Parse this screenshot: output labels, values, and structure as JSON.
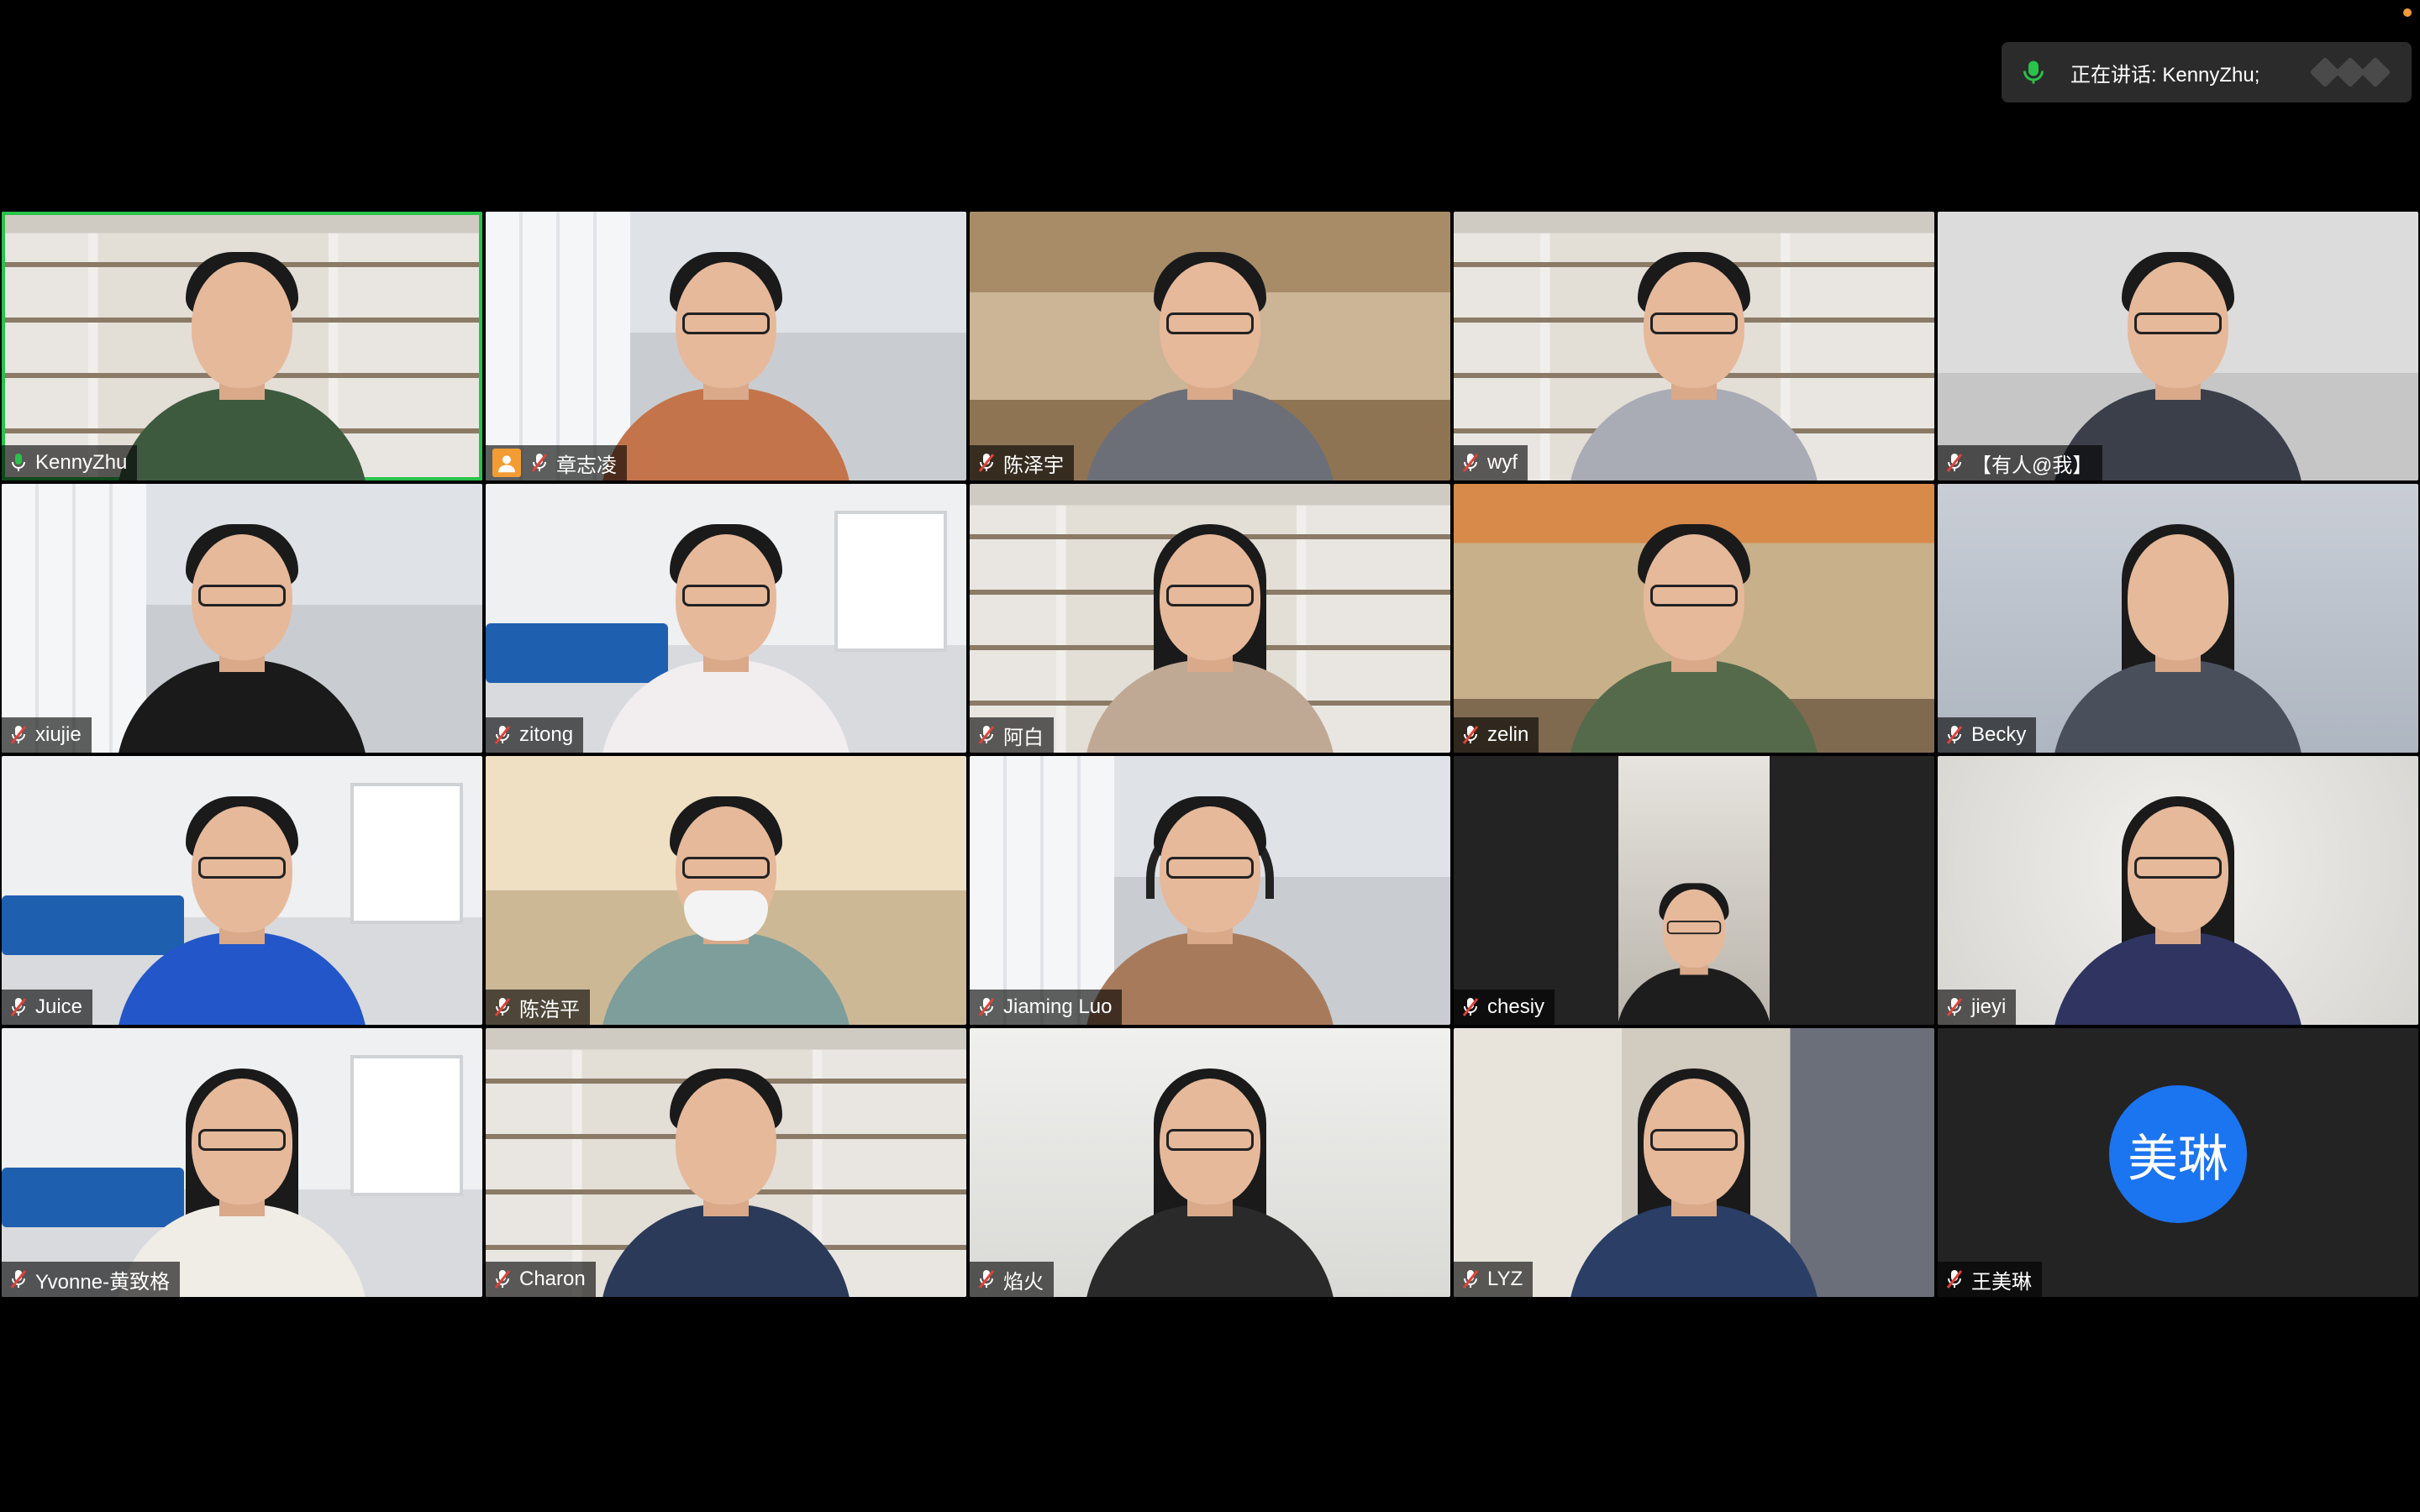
{
  "speaker": {
    "label": "正在讲话: KennyZhu;"
  },
  "participants": [
    {
      "name": "KennyZhu",
      "muted": false,
      "active": true,
      "bg": "bg-shelf"
    },
    {
      "name": "章志凌",
      "muted": true,
      "host_icon": true,
      "bg": "bg-office"
    },
    {
      "name": "陈泽宇",
      "muted": true,
      "bg": "bg-dorm"
    },
    {
      "name": "wyf",
      "muted": true,
      "bg": "bg-shelf"
    },
    {
      "name": "【有人@我】",
      "muted": true,
      "bg": "bg-room"
    },
    {
      "name": "xiujie",
      "muted": true,
      "bg": "bg-office"
    },
    {
      "name": "zitong",
      "muted": true,
      "bg": "bg-lounge"
    },
    {
      "name": "阿白",
      "muted": true,
      "bg": "bg-shelf"
    },
    {
      "name": "zelin",
      "muted": true,
      "bg": "bg-orange"
    },
    {
      "name": "Becky",
      "muted": true,
      "bg": "bg-blue-room"
    },
    {
      "name": "Juice",
      "muted": true,
      "bg": "bg-lounge"
    },
    {
      "name": "陈浩平",
      "muted": true,
      "bg": "bg-warm"
    },
    {
      "name": "Jiaming Luo",
      "muted": true,
      "bg": "bg-office"
    },
    {
      "name": "chesiy",
      "muted": true,
      "bg": "bg-dark"
    },
    {
      "name": "jieyi",
      "muted": true,
      "bg": "bg-blur"
    },
    {
      "name": "Yvonne-黄致格",
      "muted": true,
      "bg": "bg-lounge"
    },
    {
      "name": "Charon",
      "muted": true,
      "bg": "bg-shelf"
    },
    {
      "name": "焰火",
      "muted": true,
      "bg": "bg-plain"
    },
    {
      "name": "LYZ",
      "muted": true,
      "bg": "bg-dorm2"
    },
    {
      "name": "王美琳",
      "muted": true,
      "bg": "bg-dark",
      "avatar_text": "美琳",
      "avatar_color": "#1b74f0"
    }
  ],
  "colors": {
    "active_border": "#29c24a",
    "speaker_mic": "#29c24a",
    "muted_mic": "#e0423a",
    "host_badge": "#f39c34"
  }
}
